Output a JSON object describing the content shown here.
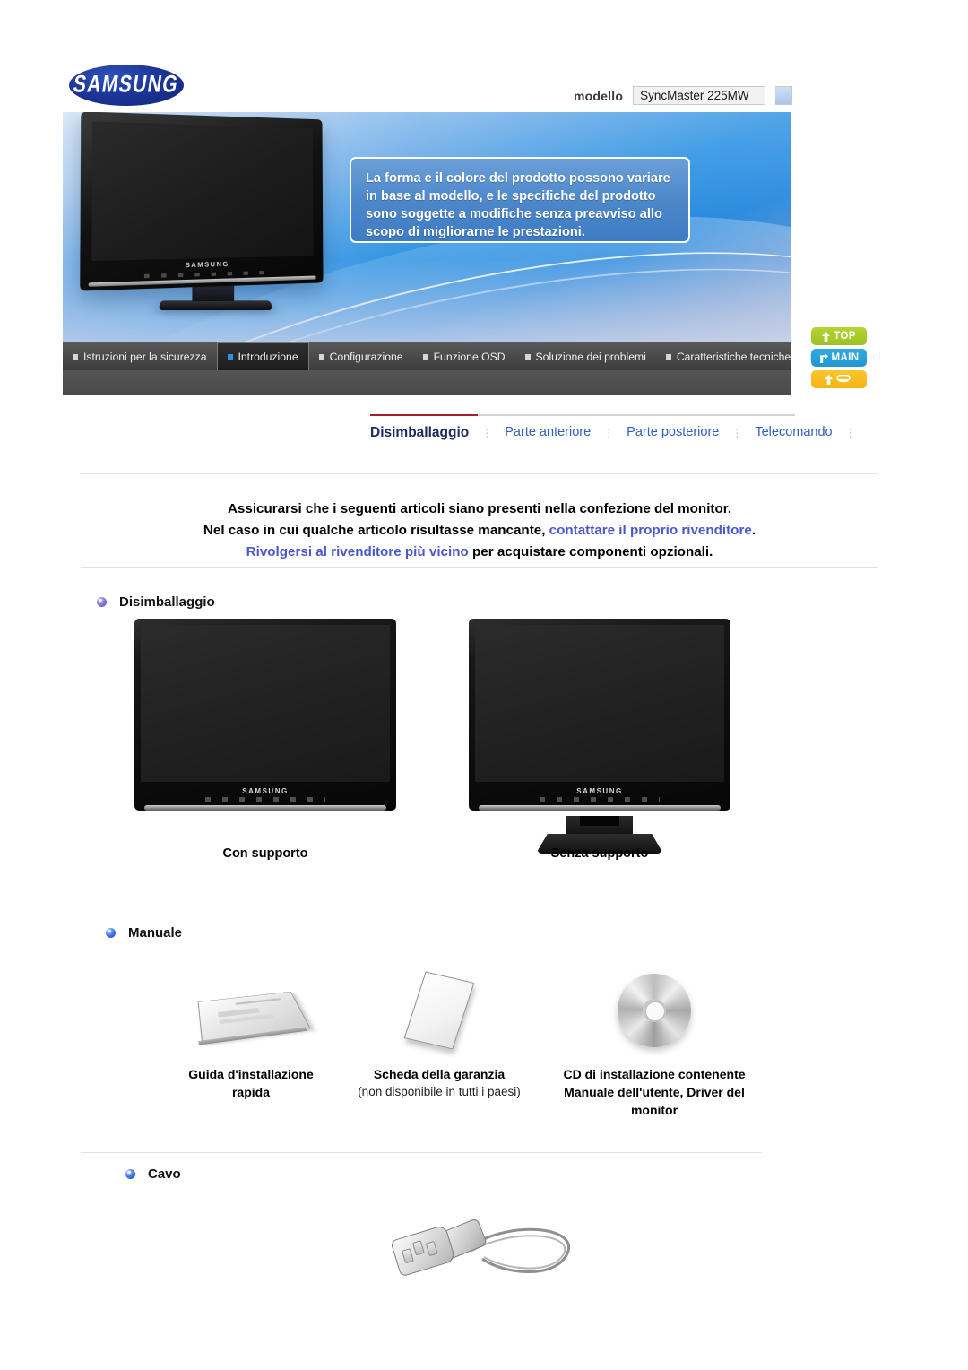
{
  "header": {
    "brand": "SAMSUNG",
    "model_label": "modello",
    "model_value": "SyncMaster 225MW",
    "callout": "La forma e il colore del prodotto possono variare in base al modello, e le specifiche del prodotto sono soggette a modifiche senza preavviso allo scopo di migliorarne le prestazioni."
  },
  "main_nav": {
    "items": [
      {
        "label": "Istruzioni per la sicurezza",
        "active": false
      },
      {
        "label": "Introduzione",
        "active": true
      },
      {
        "label": "Configurazione",
        "active": false
      },
      {
        "label": "Funzione OSD",
        "active": false
      },
      {
        "label": "Soluzione dei problemi",
        "active": false
      },
      {
        "label": "Caratteristiche tecniche",
        "active": false
      },
      {
        "label": "Informazioni",
        "active": false
      }
    ]
  },
  "side_buttons": [
    {
      "label": "TOP",
      "color": "#a9cc2e",
      "icon": "arrow-up-icon"
    },
    {
      "label": "MAIN",
      "color": "#2aa0da",
      "icon": "arrow-turn-icon"
    },
    {
      "label": "",
      "color": "#f8bd1f",
      "icon": "arrow-up-eye-icon"
    }
  ],
  "sub_nav": {
    "items": [
      {
        "label": "Disimballaggio",
        "active": true
      },
      {
        "label": "Parte anteriore",
        "active": false
      },
      {
        "label": "Parte posteriore",
        "active": false
      },
      {
        "label": "Telecomando",
        "active": false
      }
    ],
    "separator": "⋮"
  },
  "notice": {
    "line1": "Assicurarsi che i seguenti articoli siano presenti nella confezione del monitor.",
    "line2_a": "Nel caso in cui qualche articolo risultasse mancante, ",
    "line2_link": "contattare il proprio rivenditore",
    "line2_b": ".",
    "line3_link": "Rivolgersi al rivenditore più vicino",
    "line3_b": " per acquistare componenti opzionali."
  },
  "sections": {
    "unpacking": {
      "heading": "Disimballaggio",
      "items": [
        {
          "caption": "Con supporto",
          "has_stand": false
        },
        {
          "caption": "Senza supporto",
          "has_stand": true
        }
      ]
    },
    "manual": {
      "heading": "Manuale",
      "items": [
        {
          "icon": "booklet-icon",
          "title": "Guida d'installazione rapida",
          "subtitle": ""
        },
        {
          "icon": "warranty-card-icon",
          "title": "Scheda della garanzia",
          "subtitle": "(non disponibile in tutti i paesi)"
        },
        {
          "icon": "cd-disc-icon",
          "title": "CD di installazione contenente Manuale dell'utente, Driver del monitor",
          "subtitle": ""
        }
      ]
    },
    "cable": {
      "heading": "Cavo",
      "items": [
        {
          "icon": "power-cable-icon",
          "caption": ""
        }
      ]
    }
  },
  "colors": {
    "accent_red": "#a81f27",
    "link_blue": "#2f5fbf",
    "notice_link": "#4a58c8",
    "active_navy": "#1c2b5e"
  }
}
